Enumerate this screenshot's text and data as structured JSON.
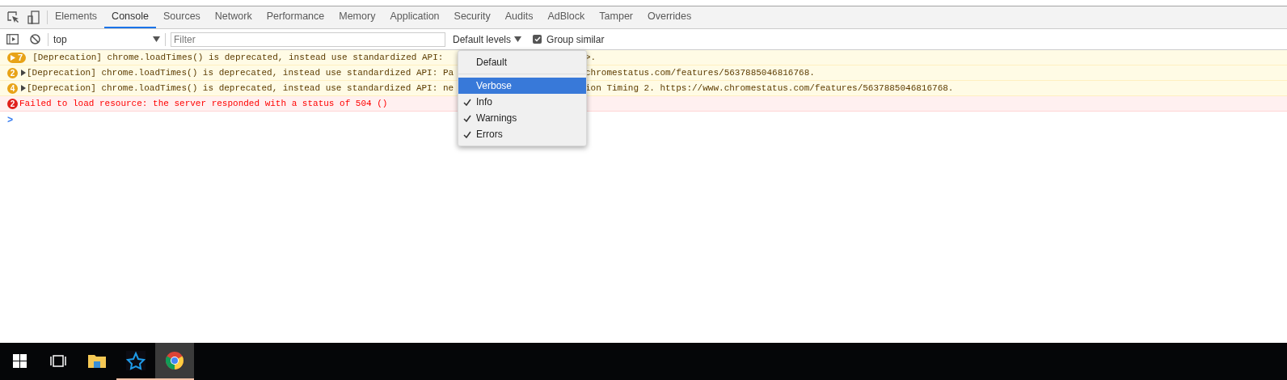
{
  "tabs": [
    {
      "label": "Elements",
      "selected": false
    },
    {
      "label": "Console",
      "selected": true
    },
    {
      "label": "Sources",
      "selected": false
    },
    {
      "label": "Network",
      "selected": false
    },
    {
      "label": "Performance",
      "selected": false
    },
    {
      "label": "Memory",
      "selected": false
    },
    {
      "label": "Application",
      "selected": false
    },
    {
      "label": "Security",
      "selected": false
    },
    {
      "label": "Audits",
      "selected": false
    },
    {
      "label": "AdBlock",
      "selected": false
    },
    {
      "label": "Tamper",
      "selected": false
    },
    {
      "label": "Overrides",
      "selected": false
    }
  ],
  "toolbar": {
    "context": "top",
    "filter_placeholder": "Filter",
    "levels_label": "Default levels",
    "group_similar": {
      "label": "Group similar",
      "checked": true
    }
  },
  "messages": [
    {
      "kind": "warning",
      "count": "7",
      "grouped": true,
      "before": "[Deprecation] chrome.loadTimes() is deprecated, instead use standardized API: ",
      "after": ">."
    },
    {
      "kind": "warning",
      "count": "2",
      "grouped": false,
      "before": "[Deprecation] chrome.loadTimes() is deprecated, instead use standardized API: Pa",
      "after": "chromestatus.com/features/5637885046816768."
    },
    {
      "kind": "warning",
      "count": "4",
      "grouped": false,
      "before": "[Deprecation] chrome.loadTimes() is deprecated, instead use standardized API: ne",
      "after": "ion Timing 2. https://www.chromestatus.com/features/5637885046816768."
    },
    {
      "kind": "error",
      "count": "2",
      "grouped": false,
      "before": "Failed to load resource: the server responded with a status of 504 ()"
    }
  ],
  "prompt": ">",
  "levels_menu": [
    {
      "label": "Default",
      "kind": "preset",
      "selected": false
    },
    {
      "label": "Verbose",
      "kind": "level",
      "checked": false,
      "selected": true
    },
    {
      "label": "Info",
      "kind": "level",
      "checked": true,
      "selected": false
    },
    {
      "label": "Warnings",
      "kind": "level",
      "checked": true,
      "selected": false
    },
    {
      "label": "Errors",
      "kind": "level",
      "checked": true,
      "selected": false
    }
  ],
  "taskbar": [
    {
      "kind": "start",
      "running": false,
      "selected": false
    },
    {
      "kind": "taskview",
      "running": false,
      "selected": false
    },
    {
      "kind": "explorer",
      "running": false,
      "selected": false
    },
    {
      "kind": "battlenet",
      "running": true,
      "selected": false
    },
    {
      "kind": "chrome",
      "running": true,
      "selected": true
    }
  ]
}
